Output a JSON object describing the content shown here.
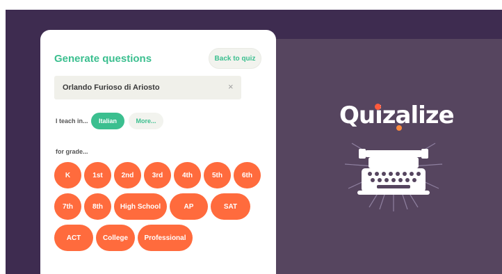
{
  "panel": {
    "title": "Generate questions",
    "back_label": "Back to quiz",
    "topic_value": "Orlando Furioso di Ariosto",
    "clear_symbol": "×",
    "teach_label": "I teach in...",
    "language_selected": "Italian",
    "language_more": "More...",
    "grade_label": "for grade...",
    "grades": [
      "K",
      "1st",
      "2nd",
      "3rd",
      "4th",
      "5th",
      "6th",
      "7th",
      "8th",
      "High School",
      "AP",
      "SAT",
      "ACT",
      "College",
      "Professional"
    ]
  },
  "brand": {
    "logo_text": "Quizalize",
    "icon": "typewriter-icon"
  },
  "colors": {
    "accent_green": "#3bbf8f",
    "chip_orange": "#ff6b3d",
    "backdrop": "#3e2c50",
    "panel_right": "#56455f"
  }
}
